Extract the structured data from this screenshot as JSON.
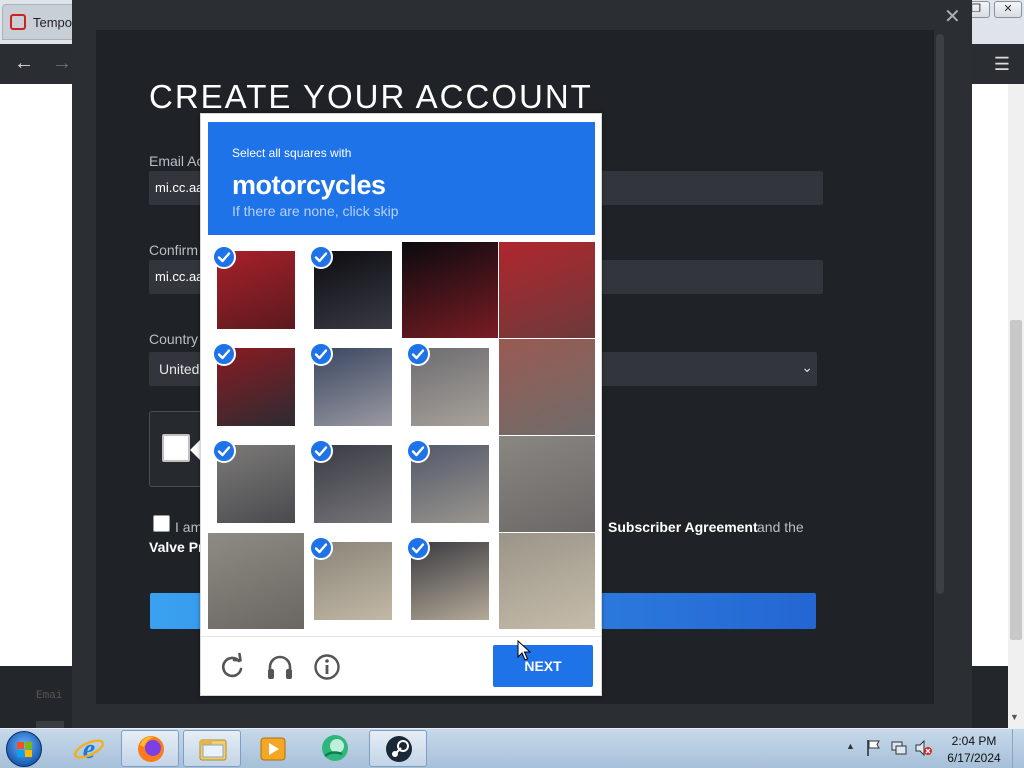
{
  "browser": {
    "tab_label": "Tempor",
    "window_controls": [
      "minimize-icon",
      "restore-icon",
      "close-icon"
    ],
    "footer_text": "Emai"
  },
  "signup": {
    "title": "CREATE YOUR ACCOUNT",
    "email_label": "Email Ac",
    "email_value": "mi.cc.aa",
    "confirm_label": "Confirm",
    "confirm_value": "mi.cc.aa",
    "country_label": "Country",
    "country_value": "United",
    "agree_text_start": "I am",
    "agree_link": "Subscriber Agreement",
    "agree_text_and": "and the",
    "privacy_link": "Valve Pr"
  },
  "captcha": {
    "prompt": "Select all squares with",
    "target": "motorcycles",
    "skip_hint": "If there are none, click skip",
    "next_label": "NEXT",
    "accent": "#1f73e8",
    "tiles": [
      {
        "row": 0,
        "col": 0,
        "selected": true
      },
      {
        "row": 0,
        "col": 1,
        "selected": true
      },
      {
        "row": 0,
        "col": 2,
        "selected": false
      },
      {
        "row": 0,
        "col": 3,
        "selected": false
      },
      {
        "row": 1,
        "col": 0,
        "selected": true
      },
      {
        "row": 1,
        "col": 1,
        "selected": true
      },
      {
        "row": 1,
        "col": 2,
        "selected": true
      },
      {
        "row": 1,
        "col": 3,
        "selected": false
      },
      {
        "row": 2,
        "col": 0,
        "selected": true
      },
      {
        "row": 2,
        "col": 1,
        "selected": true
      },
      {
        "row": 2,
        "col": 2,
        "selected": true
      },
      {
        "row": 2,
        "col": 3,
        "selected": false
      },
      {
        "row": 3,
        "col": 0,
        "selected": false
      },
      {
        "row": 3,
        "col": 1,
        "selected": true
      },
      {
        "row": 3,
        "col": 2,
        "selected": true
      },
      {
        "row": 3,
        "col": 3,
        "selected": false
      }
    ],
    "footer_icons": [
      "refresh-icon",
      "audio-headphones-icon",
      "info-icon"
    ]
  },
  "taskbar": {
    "apps": [
      "internet-explorer-icon",
      "firefox-icon",
      "file-explorer-icon",
      "media-player-icon",
      "app-green-icon",
      "steam-icon"
    ],
    "clock_time": "2:04 PM",
    "clock_date": "6/17/2024"
  }
}
